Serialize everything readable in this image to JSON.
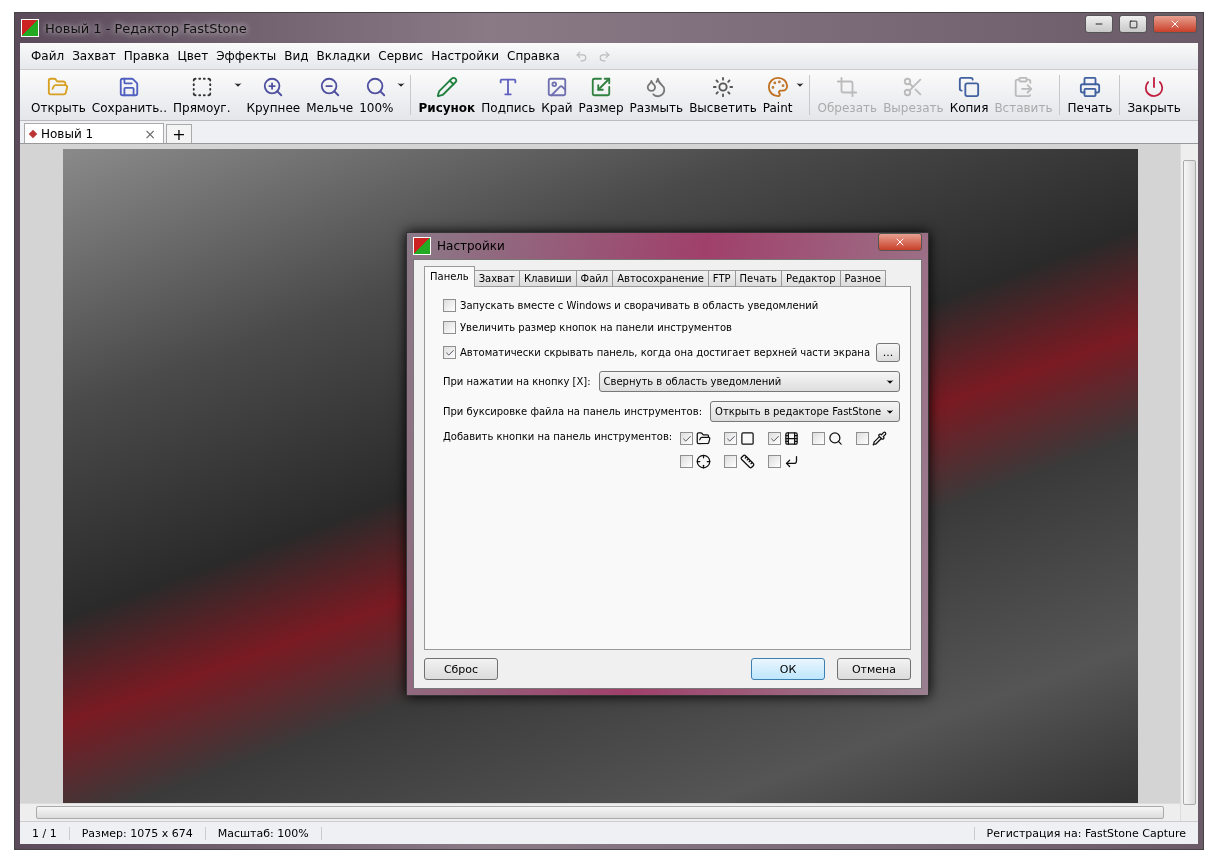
{
  "window": {
    "title": "Новый 1 - Редактор FastStone"
  },
  "menu": [
    "Файл",
    "Захват",
    "Правка",
    "Цвет",
    "Эффекты",
    "Вид",
    "Вкладки",
    "Сервис",
    "Настройки",
    "Справка"
  ],
  "toolbar": [
    {
      "kind": "button",
      "label": "Открыть",
      "disabled": false,
      "emphasized": false,
      "has_menu": false
    },
    {
      "kind": "button",
      "label": "Сохранить..",
      "disabled": false,
      "emphasized": false,
      "has_menu": false
    },
    {
      "kind": "button",
      "label": "Прямоуг.",
      "disabled": false,
      "emphasized": false,
      "has_menu": true
    },
    {
      "kind": "button",
      "label": "Крупнее",
      "disabled": false,
      "emphasized": false,
      "has_menu": false
    },
    {
      "kind": "button",
      "label": "Мельче",
      "disabled": false,
      "emphasized": false,
      "has_menu": false
    },
    {
      "kind": "button",
      "label": "100%",
      "disabled": false,
      "emphasized": false,
      "has_menu": true
    },
    {
      "kind": "separator"
    },
    {
      "kind": "button",
      "label": "Рисунок",
      "disabled": false,
      "emphasized": true,
      "has_menu": false
    },
    {
      "kind": "button",
      "label": "Подпись",
      "disabled": false,
      "emphasized": false,
      "has_menu": false
    },
    {
      "kind": "button",
      "label": "Край",
      "disabled": false,
      "emphasized": false,
      "has_menu": false
    },
    {
      "kind": "button",
      "label": "Размер",
      "disabled": false,
      "emphasized": false,
      "has_menu": false
    },
    {
      "kind": "button",
      "label": "Размыть",
      "disabled": false,
      "emphasized": false,
      "has_menu": false
    },
    {
      "kind": "button",
      "label": "Высветить",
      "disabled": false,
      "emphasized": false,
      "has_menu": false
    },
    {
      "kind": "button",
      "label": "Paint",
      "disabled": false,
      "emphasized": false,
      "has_menu": true
    },
    {
      "kind": "separator"
    },
    {
      "kind": "button",
      "label": "Обрезать",
      "disabled": true,
      "emphasized": false,
      "has_menu": false
    },
    {
      "kind": "button",
      "label": "Вырезать",
      "disabled": true,
      "emphasized": false,
      "has_menu": false
    },
    {
      "kind": "button",
      "label": "Копия",
      "disabled": false,
      "emphasized": false,
      "has_menu": false
    },
    {
      "kind": "button",
      "label": "Вставить",
      "disabled": true,
      "emphasized": false,
      "has_menu": false
    },
    {
      "kind": "separator"
    },
    {
      "kind": "button",
      "label": "Печать",
      "disabled": false,
      "emphasized": false,
      "has_menu": false
    },
    {
      "kind": "separator"
    },
    {
      "kind": "button",
      "label": "Закрыть",
      "disabled": false,
      "emphasized": false,
      "has_menu": false
    }
  ],
  "doc_tabs": {
    "tabs": [
      {
        "label": "Новый 1",
        "close": "×",
        "selected": true
      }
    ],
    "add": "+"
  },
  "dialog": {
    "title": "Настройки",
    "tabs": [
      {
        "label": "Панель",
        "selected": true
      },
      {
        "label": "Захват",
        "selected": false
      },
      {
        "label": "Клавиши",
        "selected": false
      },
      {
        "label": "Файл",
        "selected": false
      },
      {
        "label": "Автосохранение",
        "selected": false
      },
      {
        "label": "FTP",
        "selected": false
      },
      {
        "label": "Печать",
        "selected": false
      },
      {
        "label": "Редактор",
        "selected": false
      },
      {
        "label": "Разное",
        "selected": false
      }
    ],
    "checkboxes": [
      {
        "label": "Запускать вместе с Windows и сворачивать в область уведомлений",
        "checked": false
      },
      {
        "label": "Увеличить размер кнопок на панели инструментов",
        "checked": false
      },
      {
        "label": "Автоматически скрывать панель, когда она достигает верхней части экрана",
        "checked": true,
        "more": "..."
      }
    ],
    "selects": [
      {
        "label": "При нажатии на кнопку [X]:",
        "value": "Свернуть в область уведомлений"
      },
      {
        "label": "При буксировке файла на панель инструментов:",
        "value": "Открыть в редакторе FastStone"
      }
    ],
    "add_buttons": {
      "label": "Добавить кнопки на панель инструментов:",
      "items": [
        {
          "checked": true
        },
        {
          "checked": true
        },
        {
          "checked": true
        },
        {
          "checked": false
        },
        {
          "checked": false
        },
        {
          "checked": false
        },
        {
          "checked": false
        },
        {
          "checked": false
        }
      ]
    },
    "buttons": [
      {
        "label": "Сброс",
        "default": false
      },
      {
        "label": "ОК",
        "default": true
      },
      {
        "label": "Отмена",
        "default": false
      }
    ]
  },
  "status_bar": [
    "1 / 1",
    "Размер: 1075 x 674",
    "Масштаб: 100%",
    "Регистрация на: FastStone Capture"
  ]
}
